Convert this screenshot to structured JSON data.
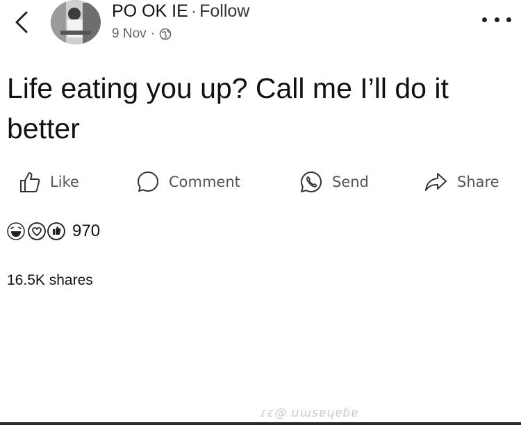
{
  "header": {
    "back_icon": "chevron-left-icon",
    "author_name": "PO OK IE",
    "separator": "·",
    "follow_label": "Follow",
    "date": "9 Nov",
    "meta_separator": "·",
    "audience_icon": "globe-icon",
    "more_icon": "more-horizontal-icon"
  },
  "post": {
    "text": "Life eating you up? Call me I’ll do it better"
  },
  "actions": {
    "like_label": "Like",
    "comment_label": "Comment",
    "send_label": "Send",
    "share_label": "Share"
  },
  "reactions": {
    "icons": [
      "haha-reaction-icon",
      "love-reaction-icon",
      "like-reaction-icon"
    ],
    "count": "970"
  },
  "shares": {
    "text": "16.5K shares"
  },
  "colors": {
    "text_primary": "#111111",
    "text_secondary": "#555555",
    "background": "#ffffff"
  }
}
